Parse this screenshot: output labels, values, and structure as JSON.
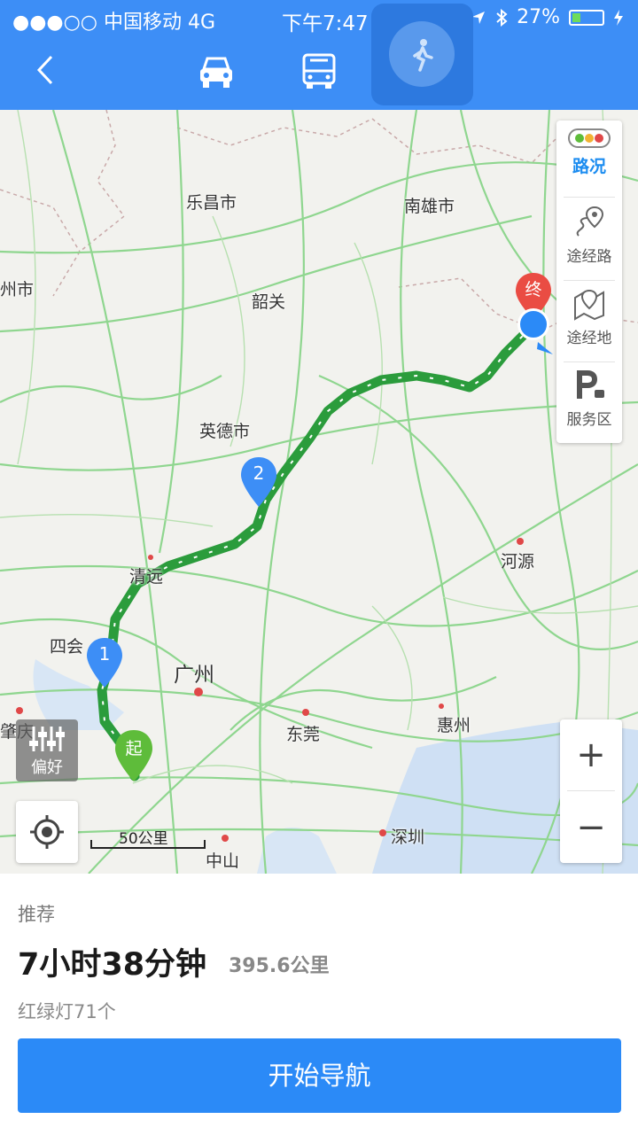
{
  "status_bar": {
    "carrier": "●●●○○ 中国移动  4G",
    "time": "下午7:47",
    "battery": "27%",
    "battery_level": 0.27
  },
  "header": {
    "modes": [
      "car-icon",
      "bus-icon",
      "walk-icon"
    ],
    "selected_mode": "walk-icon",
    "accent_color": "#3d8ef6"
  },
  "map": {
    "cities": [
      {
        "name": "乐昌市"
      },
      {
        "name": "南雄市"
      },
      {
        "name": "州市"
      },
      {
        "name": "韶关"
      },
      {
        "name": "英德市"
      },
      {
        "name": "清远"
      },
      {
        "name": "四会"
      },
      {
        "name": "广州"
      },
      {
        "name": "河源"
      },
      {
        "name": "肇庆"
      },
      {
        "name": "东莞"
      },
      {
        "name": "惠州"
      },
      {
        "name": "深圳"
      },
      {
        "name": "中山"
      }
    ],
    "markers": {
      "start": "起",
      "end": "终",
      "waypoint1": "1",
      "waypoint2": "2"
    },
    "scale": "50公里",
    "preference": "偏好",
    "zoom_in": "+",
    "zoom_out": "−"
  },
  "side_panel": {
    "traffic": "路况",
    "via_road": "途经路",
    "via_place": "途经地",
    "service": "服务区",
    "traffic_color": "#1b8cf0"
  },
  "route": {
    "tag": "推荐",
    "duration": "7小时38分钟",
    "distance": "395.6公里",
    "lights": "红绿灯71个",
    "start_button": "开始导航"
  }
}
